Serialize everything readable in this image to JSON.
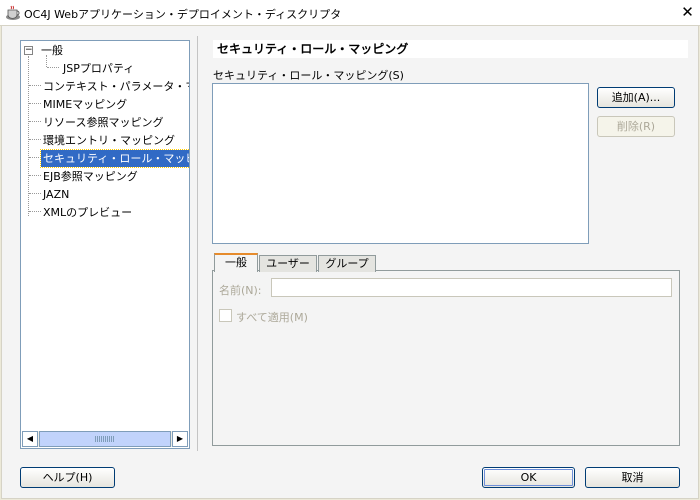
{
  "window": {
    "title": "OC4J Webアプリケーション・デプロイメント・ディスクリプタ",
    "close_glyph": "✕"
  },
  "tree": {
    "items": [
      {
        "label": "一般",
        "expander": "−"
      },
      {
        "label": "JSPプロパティ"
      },
      {
        "label": "コンテキスト・パラメータ・マッピング"
      },
      {
        "label": "MIMEマッピング"
      },
      {
        "label": "リソース参照マッピング"
      },
      {
        "label": "環境エントリ・マッピング"
      },
      {
        "label": "セキュリティ・ロール・マッピング",
        "selected": true
      },
      {
        "label": "EJB参照マッピング"
      },
      {
        "label": "JAZN"
      },
      {
        "label": "XMLのプレビュー"
      }
    ],
    "scroll_left": "◀",
    "scroll_right": "▶"
  },
  "panel": {
    "heading": "セキュリティ・ロール・マッピング",
    "list_label": "セキュリティ・ロール・マッピング(S)",
    "add_button": "追加(A)...",
    "remove_button": "削除(R)",
    "tabs": [
      {
        "label": "一般",
        "active": true
      },
      {
        "label": "ユーザー"
      },
      {
        "label": "グループ"
      }
    ],
    "name_label": "名前(N):",
    "name_value": "",
    "apply_all_label": "すべて適用(M)"
  },
  "footer": {
    "help_button": "ヘルプ(H)",
    "ok_button": "OK",
    "cancel_button": "取消"
  }
}
